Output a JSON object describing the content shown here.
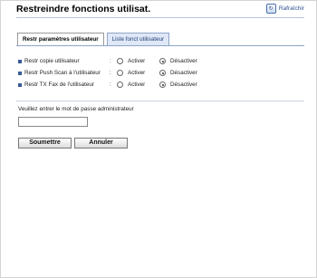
{
  "page": {
    "title": "Restreindre fonctions utilisat.",
    "refresh_label": "Rafraîchir"
  },
  "tabs": [
    {
      "label": "Restr paramètres utilisateur",
      "active": true
    },
    {
      "label": "Liste fonct utilisateur",
      "active": false
    }
  ],
  "settings": [
    {
      "label": "Restr copie utilisateur",
      "options": [
        "Activer",
        "Désactiver"
      ],
      "selected": "Désactiver"
    },
    {
      "label": "Restr Push Scan à l'utilisateur",
      "options": [
        "Activer",
        "Désactiver"
      ],
      "selected": "Désactiver"
    },
    {
      "label": "Restr TX Fax de l'utilisateur",
      "options": [
        "Activer",
        "Désactiver"
      ],
      "selected": "Désactiver"
    }
  ],
  "separator": ":",
  "password": {
    "label": "Veuillez entrer le mot de passe administrateur",
    "value": ""
  },
  "buttons": {
    "submit": "Soumettre",
    "cancel": "Annuler"
  },
  "icons": {
    "refresh": "refresh-icon",
    "bullet": "square-bullet"
  },
  "colors": {
    "accent": "#3a5c95",
    "inactive_tab_bg": "#dfe8f6"
  }
}
